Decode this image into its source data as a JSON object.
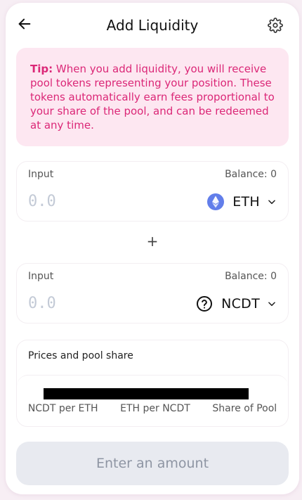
{
  "header": {
    "title": "Add Liquidity",
    "back_icon": "arrow-left-icon",
    "settings_icon": "gear-icon"
  },
  "tip": {
    "label": "Tip:",
    "text": " When you add liquidity, you will receive pool tokens representing your position. These tokens automatically earn fees proportional to your share of the pool, and can be redeemed at any time."
  },
  "input_a": {
    "label": "Input",
    "balance": "Balance: 0",
    "placeholder": "0.0",
    "token": "ETH",
    "token_icon": "ethereum-icon"
  },
  "input_b": {
    "label": "Input",
    "balance": "Balance: 0",
    "placeholder": "0.0",
    "token": "NCDT",
    "token_icon": "question-circle-icon"
  },
  "plus_symbol": "+",
  "prices": {
    "title": "Prices and pool share",
    "labels": [
      "NCDT per ETH",
      "ETH per NCDT",
      "Share of Pool"
    ]
  },
  "submit_label": "Enter an amount",
  "colors": {
    "tip_background": "#fde7f1",
    "tip_text": "#db2777",
    "eth_blue": "#627eea",
    "button_disabled_bg": "#e8eaf0",
    "button_disabled_text": "#8e95a3"
  }
}
